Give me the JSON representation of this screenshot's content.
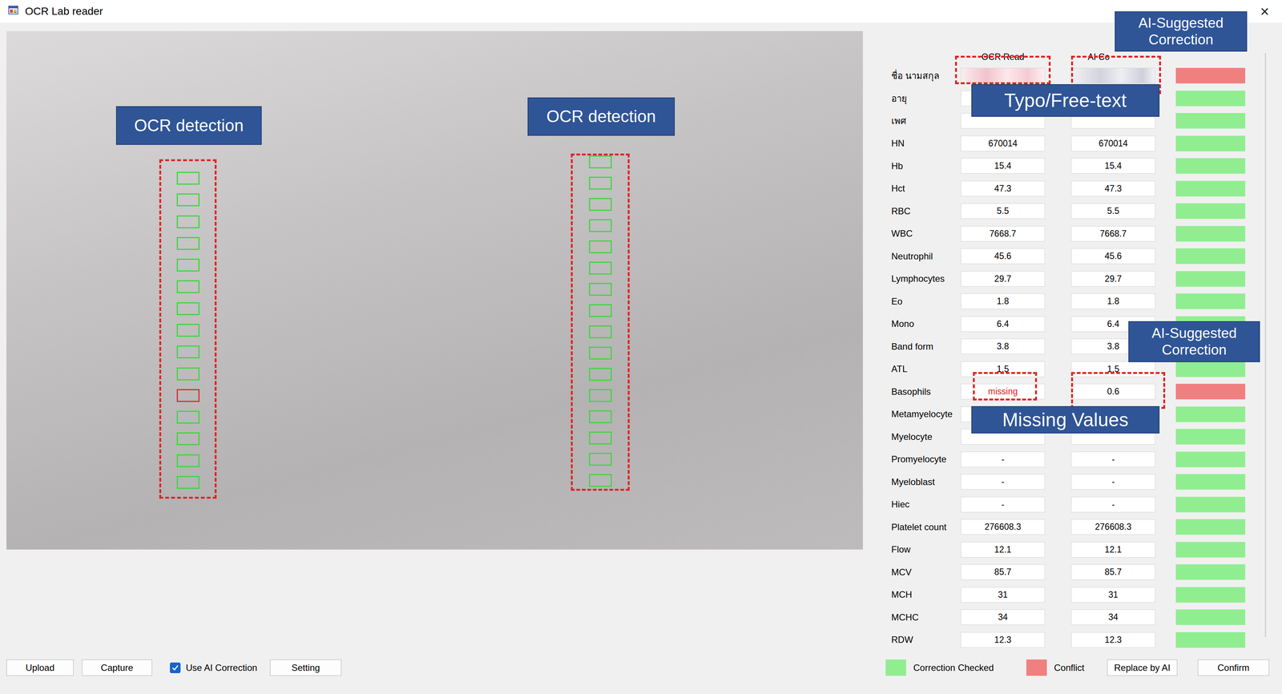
{
  "window": {
    "title": "OCR Lab reader",
    "close": "×"
  },
  "photo": {
    "labels": [
      "OCR detection",
      "OCR detection"
    ],
    "left_marks": [
      {
        "ok": true
      },
      {
        "ok": true
      },
      {
        "ok": true
      },
      {
        "ok": true
      },
      {
        "ok": true
      },
      {
        "ok": true
      },
      {
        "ok": true
      },
      {
        "ok": true
      },
      {
        "ok": true
      },
      {
        "ok": true
      },
      {
        "ok": false
      },
      {
        "ok": true
      },
      {
        "ok": true
      },
      {
        "ok": true
      },
      {
        "ok": true
      }
    ],
    "right_marks": [
      {
        "ok": true
      },
      {
        "ok": true
      },
      {
        "ok": true
      },
      {
        "ok": true
      },
      {
        "ok": true
      },
      {
        "ok": true
      },
      {
        "ok": true
      },
      {
        "ok": true
      },
      {
        "ok": true
      },
      {
        "ok": true
      },
      {
        "ok": true
      },
      {
        "ok": true
      },
      {
        "ok": true
      },
      {
        "ok": true
      },
      {
        "ok": true
      },
      {
        "ok": true
      }
    ]
  },
  "panel": {
    "columns": [
      "OCR Read",
      "AI Co"
    ],
    "rows": [
      {
        "label": "ชื่อ นามสกุล",
        "kind": "blurred",
        "color": "#f08080"
      },
      {
        "label": "อายุ",
        "kind": "value",
        "ocr": "",
        "ai": "",
        "ocr_missing": false,
        "color": "#90ee90"
      },
      {
        "label": "เพศ",
        "kind": "value",
        "ocr": "",
        "ai": "",
        "ocr_missing": false,
        "color": "#90ee90"
      },
      {
        "label": "HN",
        "kind": "value",
        "ocr": "670014",
        "ai": "670014",
        "ocr_missing": false,
        "color": "#90ee90"
      },
      {
        "label": "Hb",
        "kind": "value",
        "ocr": "15.4",
        "ai": "15.4",
        "ocr_missing": false,
        "color": "#90ee90"
      },
      {
        "label": "Hct",
        "kind": "value",
        "ocr": "47.3",
        "ai": "47.3",
        "ocr_missing": false,
        "color": "#90ee90"
      },
      {
        "label": "RBC",
        "kind": "value",
        "ocr": "5.5",
        "ai": "5.5",
        "ocr_missing": false,
        "color": "#90ee90"
      },
      {
        "label": "WBC",
        "kind": "value",
        "ocr": "7668.7",
        "ai": "7668.7",
        "ocr_missing": false,
        "color": "#90ee90"
      },
      {
        "label": "Neutrophil",
        "kind": "value",
        "ocr": "45.6",
        "ai": "45.6",
        "ocr_missing": false,
        "color": "#90ee90"
      },
      {
        "label": "Lymphocytes",
        "kind": "value",
        "ocr": "29.7",
        "ai": "29.7",
        "ocr_missing": false,
        "color": "#90ee90"
      },
      {
        "label": "Eo",
        "kind": "value",
        "ocr": "1.8",
        "ai": "1.8",
        "ocr_missing": false,
        "color": "#90ee90"
      },
      {
        "label": "Mono",
        "kind": "value",
        "ocr": "6.4",
        "ai": "6.4",
        "ocr_missing": false,
        "color": "#90ee90"
      },
      {
        "label": "Band form",
        "kind": "value",
        "ocr": "3.8",
        "ai": "3.8",
        "ocr_missing": false,
        "color": "#90ee90"
      },
      {
        "label": "ATL",
        "kind": "value",
        "ocr": "1.5",
        "ai": "1.5",
        "ocr_missing": false,
        "color": "#90ee90"
      },
      {
        "label": "Basophils",
        "kind": "value",
        "ocr": "missing",
        "ai": "0.6",
        "ocr_missing": true,
        "color": "#f08080"
      },
      {
        "label": "Metamyelocyte",
        "kind": "value",
        "ocr": "",
        "ai": "",
        "ocr_missing": false,
        "color": "#90ee90"
      },
      {
        "label": "Myelocyte",
        "kind": "value",
        "ocr": "",
        "ai": "",
        "ocr_missing": false,
        "color": "#90ee90"
      },
      {
        "label": "Promyelocyte",
        "kind": "value",
        "ocr": "-",
        "ai": "-",
        "ocr_missing": false,
        "color": "#90ee90"
      },
      {
        "label": "Myeloblast",
        "kind": "value",
        "ocr": "-",
        "ai": "-",
        "ocr_missing": false,
        "color": "#90ee90"
      },
      {
        "label": "Hiec",
        "kind": "value",
        "ocr": "-",
        "ai": "-",
        "ocr_missing": false,
        "color": "#90ee90"
      },
      {
        "label": "Platelet count",
        "kind": "value",
        "ocr": "276608.3",
        "ai": "276608.3",
        "ocr_missing": false,
        "color": "#90ee90"
      },
      {
        "label": "Flow",
        "kind": "value",
        "ocr": "12.1",
        "ai": "12.1",
        "ocr_missing": false,
        "color": "#90ee90"
      },
      {
        "label": "MCV",
        "kind": "value",
        "ocr": "85.7",
        "ai": "85.7",
        "ocr_missing": false,
        "color": "#90ee90"
      },
      {
        "label": "MCH",
        "kind": "value",
        "ocr": "31",
        "ai": "31",
        "ocr_missing": false,
        "color": "#90ee90"
      },
      {
        "label": "MCHC",
        "kind": "value",
        "ocr": "34",
        "ai": "34",
        "ocr_missing": false,
        "color": "#90ee90"
      },
      {
        "label": "RDW",
        "kind": "value",
        "ocr": "12.3",
        "ai": "12.3",
        "ocr_missing": false,
        "color": "#90ee90"
      }
    ]
  },
  "callouts": [
    "AI-Suggested Correction",
    "Typo/Free-text",
    "AI-Suggested Correction",
    "Missing Values"
  ],
  "toolbar": {
    "upload": "Upload",
    "capture": "Capture",
    "checkbox": {
      "label": "Use AI Correction",
      "checked": true
    },
    "setting": "Setting"
  },
  "legend": [
    {
      "label": "Correction Checked",
      "color": "#90ee90"
    },
    {
      "label": "Conflict",
      "color": "#f08080"
    }
  ],
  "actions": [
    "Replace by AI",
    "Confirm"
  ]
}
